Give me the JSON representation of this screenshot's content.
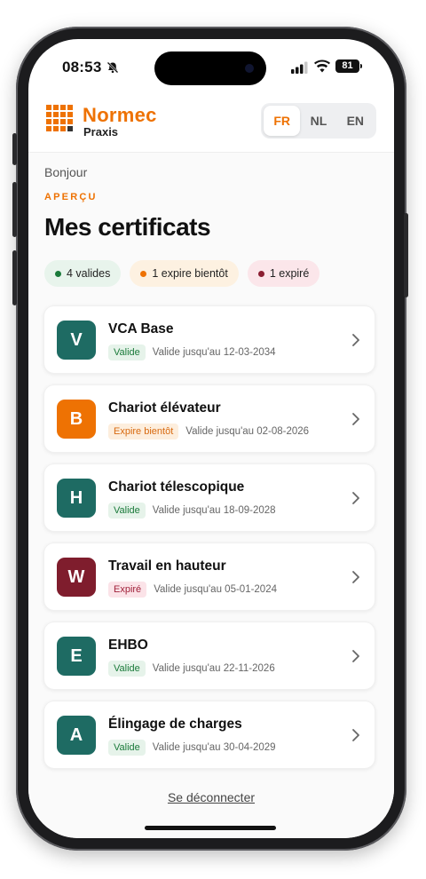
{
  "status_bar": {
    "time": "08:53",
    "battery": "81"
  },
  "header": {
    "brand": "Normec",
    "brand_sub": "Praxis",
    "languages": [
      "FR",
      "NL",
      "EN"
    ],
    "active_language": "FR"
  },
  "main": {
    "greeting": "Bonjour",
    "eyebrow": "APERÇU",
    "title": "Mes certificats",
    "summary": {
      "valid": "4 valides",
      "soon": "1 expire bientôt",
      "expired": "1 expiré"
    },
    "certificates": [
      {
        "initial": "V",
        "name": "VCA Base",
        "status": "Valide",
        "status_type": "valid",
        "valid_until": "Valide jusqu'au 12-03-2034",
        "color": "#1e6b63"
      },
      {
        "initial": "B",
        "name": "Chariot élévateur",
        "status": "Expire bientôt",
        "status_type": "soon",
        "valid_until": "Valide jusqu'au 02-08-2026",
        "color": "#ee7203"
      },
      {
        "initial": "H",
        "name": "Chariot télescopique",
        "status": "Valide",
        "status_type": "valid",
        "valid_until": "Valide jusqu'au 18-09-2028",
        "color": "#1e6b63"
      },
      {
        "initial": "W",
        "name": "Travail en hauteur",
        "status": "Expiré",
        "status_type": "expired",
        "valid_until": "Valide jusqu'au 05-01-2024",
        "color": "#7f1d2d"
      },
      {
        "initial": "E",
        "name": "EHBO",
        "status": "Valide",
        "status_type": "valid",
        "valid_until": "Valide jusqu'au 22-11-2026",
        "color": "#1e6b63"
      },
      {
        "initial": "A",
        "name": "Élingage de charges",
        "status": "Valide",
        "status_type": "valid",
        "valid_until": "Valide jusqu'au 30-04-2029",
        "color": "#1e6b63"
      }
    ],
    "logout": "Se déconnecter"
  },
  "colors": {
    "brand_orange": "#ee7203",
    "teal": "#1e6b63",
    "burgundy": "#7f1d2d"
  }
}
